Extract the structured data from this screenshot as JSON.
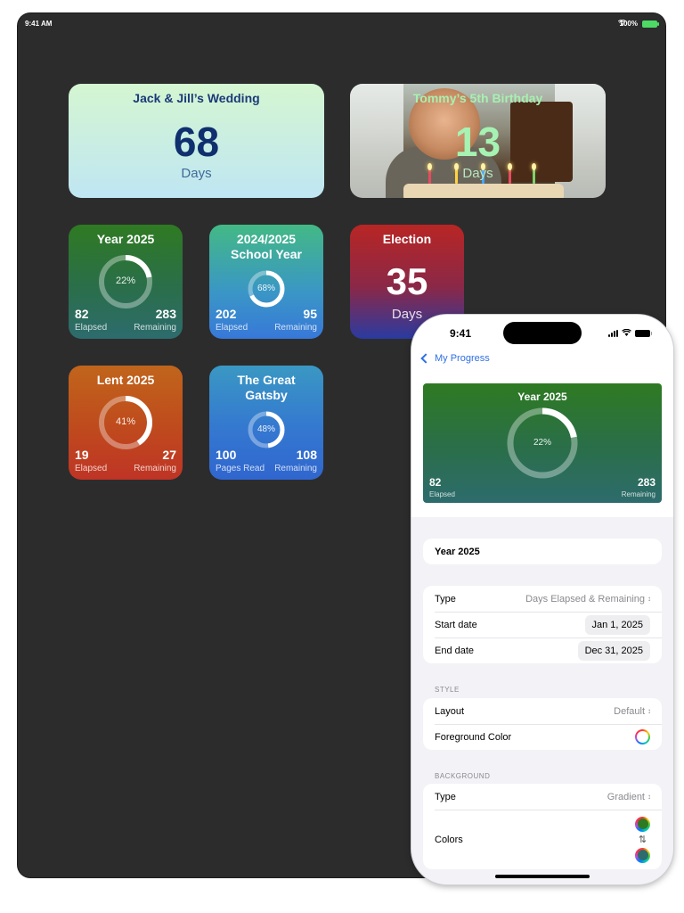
{
  "ipad": {
    "status": {
      "time": "9:41 AM",
      "battery": "100%"
    },
    "widgets": {
      "wedding": {
        "title": "Jack & Jill’s Wedding",
        "number": "68",
        "unit": "Days"
      },
      "birthday": {
        "title": "Tommy’s 5th Birthday",
        "number": "13",
        "unit": "Days"
      },
      "year": {
        "title": "Year 2025",
        "percent": "22%",
        "progress": 0.22,
        "left_value": "82",
        "left_label": "Elapsed",
        "right_value": "283",
        "right_label": "Remaining"
      },
      "school": {
        "title_line1": "2024/2025",
        "title_line2": "School Year",
        "percent": "68%",
        "progress": 0.68,
        "left_value": "202",
        "left_label": "Elapsed",
        "right_value": "95",
        "right_label": "Remaining"
      },
      "election": {
        "title": "Election",
        "number": "35",
        "unit": "Days"
      },
      "lent": {
        "title": "Lent 2025",
        "percent": "41%",
        "progress": 0.41,
        "left_value": "19",
        "left_label": "Elapsed",
        "right_value": "27",
        "right_label": "Remaining"
      },
      "gatsby": {
        "title_line1": "The Great",
        "title_line2": "Gatsby",
        "percent": "48%",
        "progress": 0.48,
        "left_value": "100",
        "left_label": "Pages Read",
        "right_value": "108",
        "right_label": "Remaining"
      }
    }
  },
  "iphone": {
    "status": {
      "time": "9:41"
    },
    "nav": {
      "back_label": "My Progress"
    },
    "preview": {
      "title": "Year 2025",
      "percent": "22%",
      "progress": 0.22,
      "left_value": "82",
      "left_label": "Elapsed",
      "right_value": "283",
      "right_label": "Remaining"
    },
    "form": {
      "name": "Year 2025",
      "type_label": "Type",
      "type_value": "Days Elapsed & Remaining",
      "start_label": "Start date",
      "start_value": "Jan 1, 2025",
      "end_label": "End date",
      "end_value": "Dec 31, 2025",
      "style_header": "STYLE",
      "layout_label": "Layout",
      "layout_value": "Default",
      "fg_label": "Foreground Color",
      "background_header": "BACKGROUND",
      "bg_type_label": "Type",
      "bg_type_value": "Gradient",
      "colors_label": "Colors"
    }
  },
  "colors": {
    "accent_blue": "#2f6fe4",
    "year_gradient": [
      "#2e7a22",
      "#2d6c6d"
    ],
    "wedding_text": "#0f2f6e"
  }
}
